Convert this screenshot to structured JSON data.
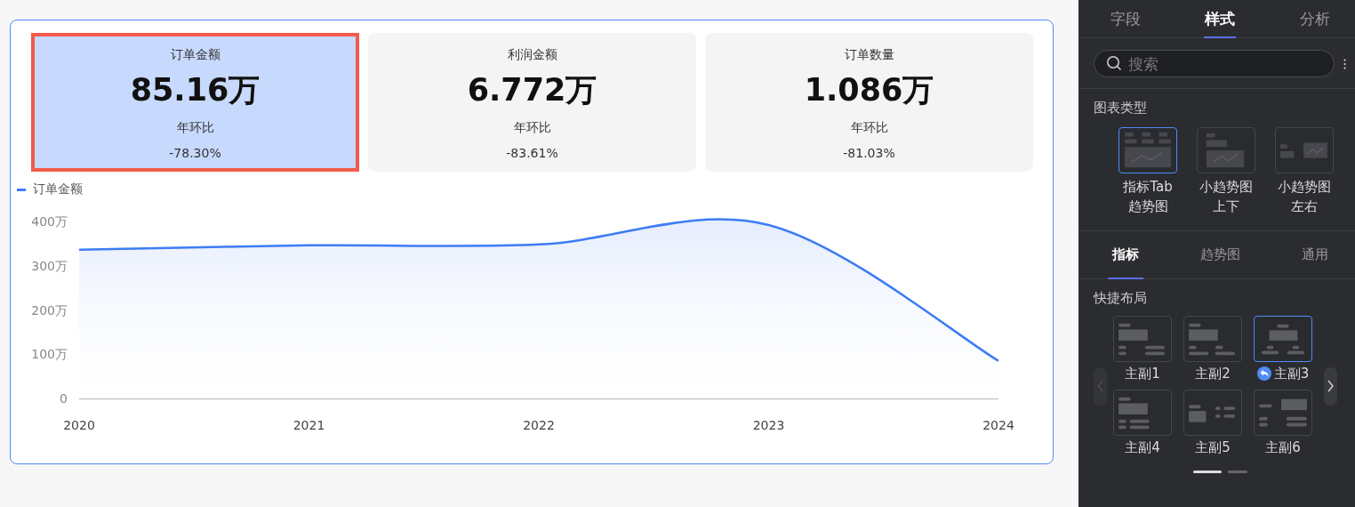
{
  "kpi_cards": [
    {
      "title": "订单金额",
      "value": "85.16万",
      "compare_label": "年环比",
      "compare_value": "-78.30%",
      "selected": true
    },
    {
      "title": "利润金额",
      "value": "6.772万",
      "compare_label": "年环比",
      "compare_value": "-83.61%",
      "selected": false
    },
    {
      "title": "订单数量",
      "value": "1.086万",
      "compare_label": "年环比",
      "compare_value": "-81.03%",
      "selected": false
    }
  ],
  "chart": {
    "chart_data": {
      "type": "area",
      "categories": [
        "2020",
        "2021",
        "2022",
        "2023",
        "2024"
      ],
      "series": [
        {
          "name": "订单金额",
          "color": "#3d7cf5",
          "values": [
            336,
            346,
            348,
            392,
            85
          ]
        }
      ],
      "ylim": [
        0,
        400
      ],
      "yticks": [
        {
          "value": 0,
          "label": "0"
        },
        {
          "value": 100,
          "label": "100万"
        },
        {
          "value": 200,
          "label": "200万"
        },
        {
          "value": 300,
          "label": "300万"
        },
        {
          "value": 400,
          "label": "400万"
        }
      ]
    }
  },
  "panel": {
    "tabs": [
      {
        "label": "字段",
        "selected": false
      },
      {
        "label": "样式",
        "selected": true
      },
      {
        "label": "分析",
        "selected": false
      }
    ],
    "search": {
      "placeholder": "搜索"
    },
    "chart_type": {
      "title": "图表类型",
      "options": [
        {
          "label_lines": [
            "指标Tab",
            "趋势图"
          ],
          "selected": true
        },
        {
          "label_lines": [
            "小趋势图",
            "上下"
          ],
          "selected": false
        },
        {
          "label_lines": [
            "小趋势图",
            "左右"
          ],
          "selected": false
        }
      ]
    },
    "sub_tabs": [
      {
        "label": "指标",
        "selected": true
      },
      {
        "label": "趋势图",
        "selected": false
      },
      {
        "label": "通用",
        "selected": false
      }
    ],
    "quick_layout": {
      "title": "快捷布局",
      "prev_disabled": true,
      "next_disabled": false,
      "items": [
        {
          "label": "主副1",
          "selected": false,
          "reset": false
        },
        {
          "label": "主副2",
          "selected": false,
          "reset": false
        },
        {
          "label": "主副3",
          "selected": true,
          "reset": true
        },
        {
          "label": "主副4",
          "selected": false,
          "reset": false
        },
        {
          "label": "主副5",
          "selected": false,
          "reset": false
        },
        {
          "label": "主副6",
          "selected": false,
          "reset": false
        }
      ],
      "pages": [
        {
          "selected": true
        },
        {
          "selected": false
        }
      ]
    }
  }
}
